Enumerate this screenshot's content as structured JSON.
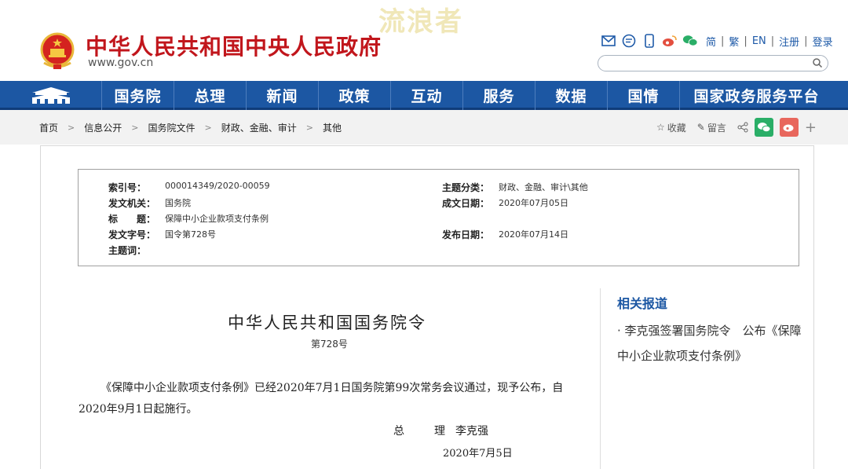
{
  "header": {
    "watermark": "流浪者",
    "site_title": "中华人民共和国中央人民政府",
    "site_url": "www.gov.cn",
    "langs": [
      "简",
      "繁",
      "EN",
      "注册",
      "登录"
    ],
    "search_placeholder": ""
  },
  "nav": {
    "items": [
      "国务院",
      "总理",
      "新闻",
      "政策",
      "互动",
      "服务",
      "数据",
      "国情",
      "国家政务服务平台"
    ]
  },
  "breadcrumb": [
    "首页",
    "信息公开",
    "国务院文件",
    "财政、金融、审计",
    "其他"
  ],
  "share": {
    "collect": "收藏",
    "comment": "留言"
  },
  "meta": {
    "index_label": "索引号：",
    "index_value": "000014349/2020-00059",
    "category_label": "主题分类：",
    "category_value": "财政、金融、审计\\其他",
    "issuer_label": "发文机关：",
    "issuer_value": "国务院",
    "created_label": "成文日期：",
    "created_value": "2020年07月05日",
    "title_label": "标　　题：",
    "title_value": "保障中小企业款项支付条例",
    "docno_label": "发文字号：",
    "docno_value": "国令第728号",
    "published_label": "发布日期：",
    "published_value": "2020年07月14日",
    "keywords_label": "主题词："
  },
  "article": {
    "title": "中华人民共和国国务院令",
    "number": "第728号",
    "body": "《保障中小企业款项支付条例》已经2020年7月1日国务院第99次常务会议通过，现予公布，自2020年9月1日起施行。",
    "sign_title": "总　理",
    "sign_name": "李克强",
    "sign_date": "2020年7月5日"
  },
  "related": {
    "title": "相关报道",
    "items": [
      "· 李克强签署国务院令　公布《保障中小企业款项支付条例》"
    ]
  },
  "colors": {
    "brand_red": "#c1161c",
    "nav_blue": "#1c57a3",
    "wechat_green": "#2aae67",
    "weibo_red": "#e8675d"
  }
}
